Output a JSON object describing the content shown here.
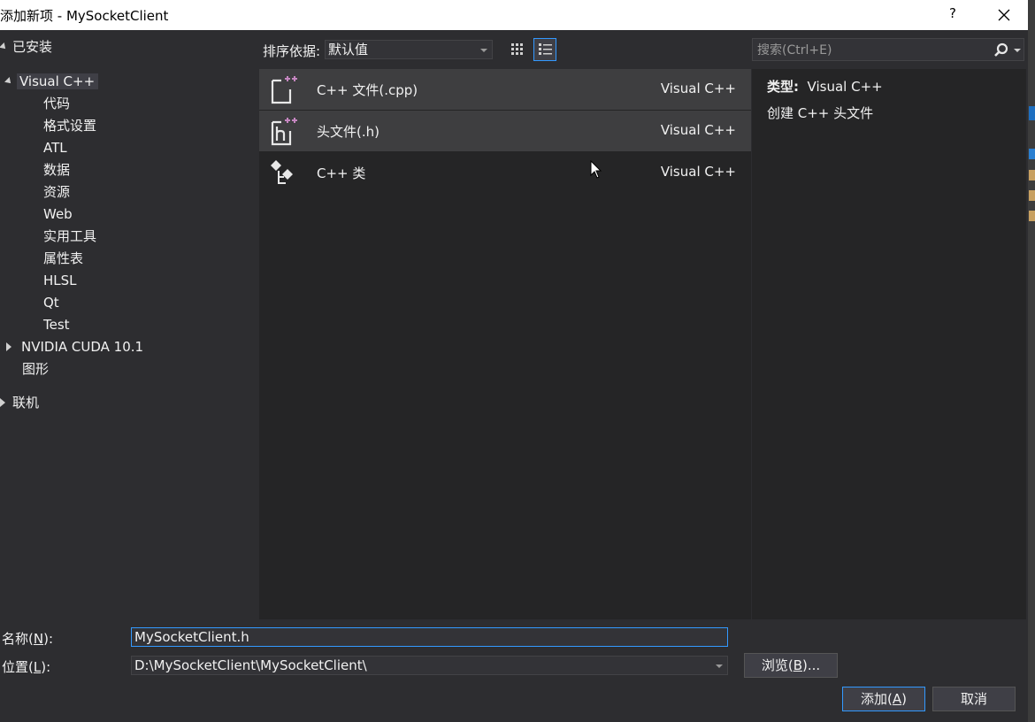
{
  "window": {
    "title": "添加新项 - MySocketClient",
    "help": "?",
    "close_icon": "close-icon"
  },
  "tree": {
    "installed": "已安装",
    "visual_cpp": "Visual C++",
    "children": [
      "代码",
      "格式设置",
      "ATL",
      "数据",
      "资源",
      "Web",
      "实用工具",
      "属性表",
      "HLSL",
      "Qt",
      "Test"
    ],
    "nvidia": "NVIDIA CUDA 10.1",
    "graphics": "图形",
    "online": "联机"
  },
  "toolbar": {
    "sort_label": "排序依据:",
    "sort_value": "默认值"
  },
  "templates": [
    {
      "name": "C++ 文件(.cpp)",
      "lang": "Visual C++",
      "icon": "cpp-file-icon"
    },
    {
      "name": "头文件(.h)",
      "lang": "Visual C++",
      "icon": "header-file-icon"
    },
    {
      "name": "C++ 类",
      "lang": "Visual C++",
      "icon": "cpp-class-icon"
    }
  ],
  "search": {
    "placeholder": "搜索(Ctrl+E)"
  },
  "details": {
    "type_label": "类型:",
    "type_value": "Visual C++",
    "description": "创建 C++ 头文件"
  },
  "form": {
    "name_label_pre": "名称(",
    "name_label_key": "N",
    "name_label_post": "):",
    "name_value": "MySocketClient.h",
    "location_label_pre": "位置(",
    "location_label_key": "L",
    "location_label_post": "):",
    "location_value": "D:\\MySocketClient\\MySocketClient\\",
    "browse_pre": "浏览(",
    "browse_key": "B",
    "browse_post": ")...",
    "add_pre": "添加(",
    "add_key": "A",
    "add_post": ")",
    "cancel": "取消"
  },
  "colors": {
    "background": "#2d2d30",
    "panel": "#252526",
    "selected": "#3e3e40",
    "accent": "#3399ff",
    "template_plus": "#c586c0"
  }
}
